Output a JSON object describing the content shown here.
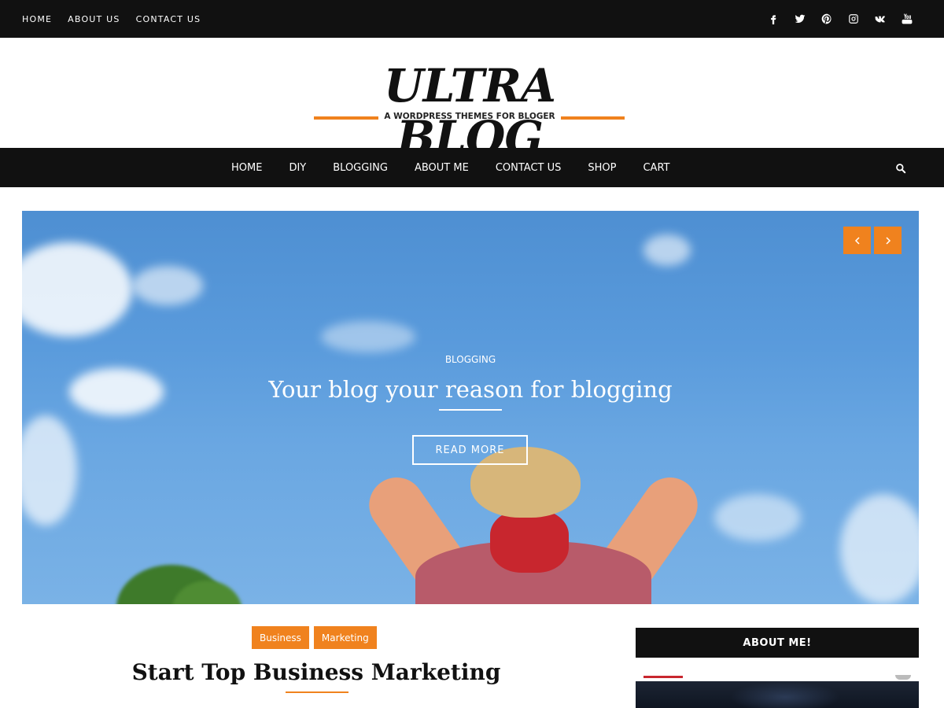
{
  "topbar": {
    "links": [
      "HOME",
      "ABOUT US",
      "CONTACT US"
    ],
    "social_icons": [
      "facebook-icon",
      "twitter-icon",
      "pinterest-icon",
      "instagram-icon",
      "vk-icon",
      "youtube-icon"
    ]
  },
  "branding": {
    "title": "ULTRA BLOG",
    "tagline": "A WORDPRESS THEMES FOR BLOGER",
    "accent_color": "#f0821e"
  },
  "main_nav": {
    "items": [
      "HOME",
      "DIY",
      "BLOGGING",
      "ABOUT ME",
      "CONTACT US",
      "SHOP",
      "CART"
    ],
    "search_icon": "search-icon"
  },
  "hero": {
    "category": "BLOGGING",
    "title": "Your blog your reason for blogging",
    "button_label": "READ MORE",
    "prev_icon": "chevron-left-icon",
    "next_icon": "chevron-right-icon"
  },
  "post": {
    "tags": [
      "Business",
      "Marketing"
    ],
    "title": "Start Top Business Marketing"
  },
  "sidebar": {
    "widget_title": "ABOUT ME!"
  }
}
